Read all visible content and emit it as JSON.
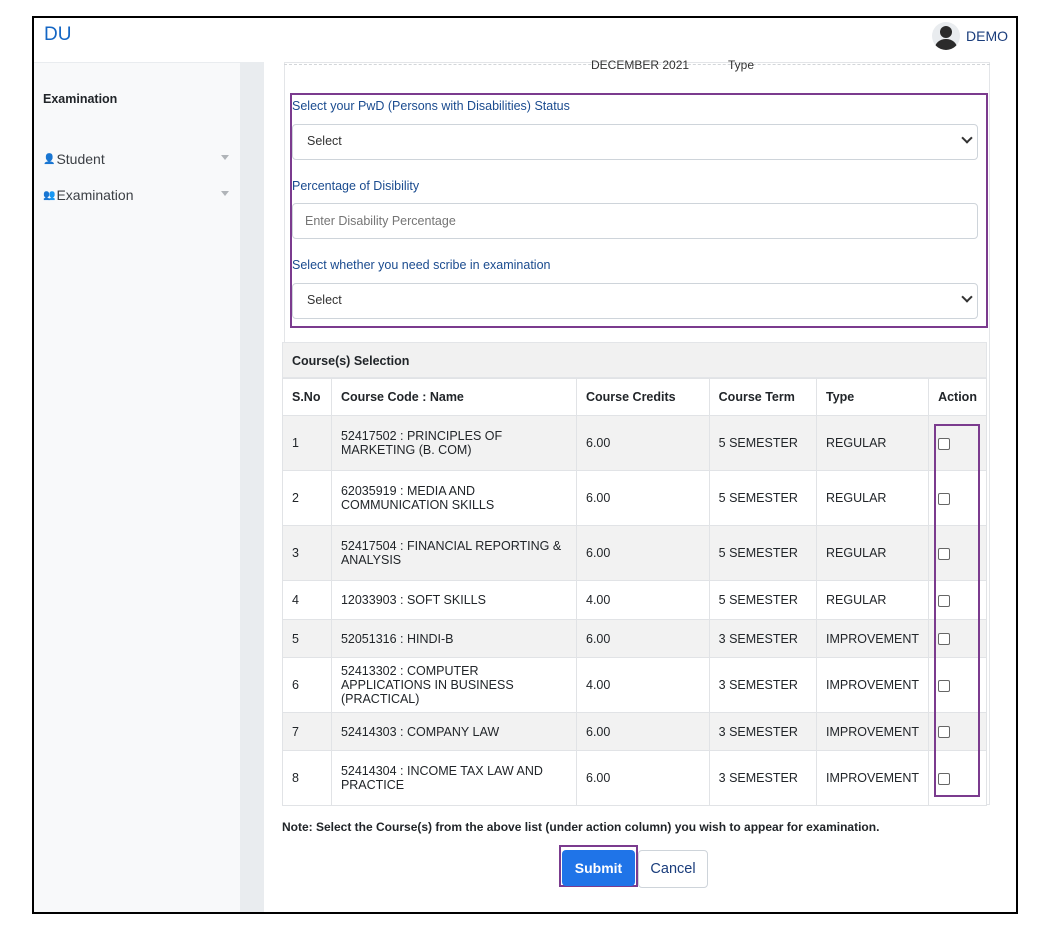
{
  "brand": "DU",
  "user": {
    "name": "DEMO"
  },
  "sidebar": {
    "title": "Examination",
    "items": [
      {
        "icon": "👤",
        "label": "Student"
      },
      {
        "icon": "👥",
        "label": "Examination"
      }
    ]
  },
  "partial_header": {
    "left": "DECEMBER 2021",
    "right": "Type"
  },
  "pwd": {
    "status_label": "Select your PwD (Persons with Disabilities) Status",
    "status_value": "Select",
    "percentage_label": "Percentage of Disibility",
    "percentage_placeholder": "Enter Disability Percentage",
    "scribe_label": "Select whether you need scribe in examination",
    "scribe_value": "Select"
  },
  "course_section": {
    "title": "Course(s) Selection",
    "columns": [
      "S.No",
      "Course Code : Name",
      "Course Credits",
      "Course Term",
      "Type",
      "Action"
    ],
    "rows": [
      {
        "sno": "1",
        "name": "52417502 : PRINCIPLES OF MARKETING (B. COM)",
        "credits": "6.00",
        "term": "5 SEMESTER",
        "type": "REGULAR",
        "checked": false
      },
      {
        "sno": "2",
        "name": "62035919 : MEDIA AND COMMUNICATION SKILLS",
        "credits": "6.00",
        "term": "5 SEMESTER",
        "type": "REGULAR",
        "checked": false
      },
      {
        "sno": "3",
        "name": "52417504 : FINANCIAL REPORTING & ANALYSIS",
        "credits": "6.00",
        "term": "5 SEMESTER",
        "type": "REGULAR",
        "checked": false
      },
      {
        "sno": "4",
        "name": "12033903 : SOFT SKILLS",
        "credits": "4.00",
        "term": "5 SEMESTER",
        "type": "REGULAR",
        "checked": false
      },
      {
        "sno": "5",
        "name": "52051316 : HINDI-B",
        "credits": "6.00",
        "term": "3 SEMESTER",
        "type": "IMPROVEMENT",
        "checked": false
      },
      {
        "sno": "6",
        "name": "52413302 : COMPUTER APPLICATIONS IN BUSINESS (PRACTICAL)",
        "credits": "4.00",
        "term": "3 SEMESTER",
        "type": "IMPROVEMENT",
        "checked": false
      },
      {
        "sno": "7",
        "name": "52414303 : COMPANY LAW",
        "credits": "6.00",
        "term": "3 SEMESTER",
        "type": "IMPROVEMENT",
        "checked": false
      },
      {
        "sno": "8",
        "name": "52414304 : INCOME TAX LAW AND PRACTICE",
        "credits": "6.00",
        "term": "3 SEMESTER",
        "type": "IMPROVEMENT",
        "checked": false
      }
    ],
    "note": "Note: Select the Course(s) from the above list (under action column) you wish to appear for examination."
  },
  "buttons": {
    "submit": "Submit",
    "cancel": "Cancel"
  },
  "colors": {
    "brand": "#1466c4",
    "accent": "#1f74e8",
    "highlight": "#7b3b8e",
    "label": "#1a4b8f"
  }
}
